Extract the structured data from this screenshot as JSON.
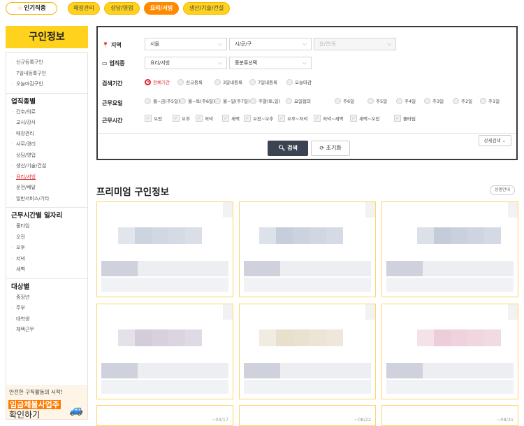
{
  "topbar": {
    "hot_label": "인기직종",
    "categories": [
      {
        "label": "매장관리",
        "active": false
      },
      {
        "label": "상담/영업",
        "active": false
      },
      {
        "label": "요리/서빙",
        "active": true
      },
      {
        "label": "생산/기술/건설",
        "active": false
      }
    ]
  },
  "sidebar": {
    "title": "구인정보",
    "recruit_items": [
      "신규등록구인",
      "7일내등록구인",
      "오늘마감구인"
    ],
    "job_head": "업직종별",
    "job_items": [
      "간호/의료",
      "교사/강사",
      "매장관리",
      "사무/경리",
      "상담/영업",
      "생산/기술/건설",
      "요리/서빙",
      "운전/배달",
      "일반서비스/기타"
    ],
    "job_selected": "요리/서빙",
    "time_head": "근무시간별 일자리",
    "time_items": [
      "풀타임",
      "오전",
      "오후",
      "저녁",
      "새벽"
    ],
    "target_head": "대상별",
    "target_items": [
      "중장년",
      "주부",
      "대학생",
      "재택근무"
    ],
    "ad": {
      "line1": "안전한 구직활동의 시작!",
      "highlight": "임금체불사업주",
      "line3": "확인하기"
    }
  },
  "filter": {
    "region_label": "지역",
    "region_select": "서울",
    "district_select": "시/군/구",
    "dong_select": "읍/면/동",
    "job_label": "업직종",
    "job_select": "요리/서빙",
    "job_sub_select": "중분류선택",
    "period_label": "검색기간",
    "period_options": [
      "전체기간",
      "신규등록",
      "3일내등록",
      "7일내등록",
      "오늘마감"
    ],
    "period_selected": 0,
    "days_label": "근무요일",
    "days_options": [
      "월~금(주5일)",
      "월~토(주6일)",
      "월~일(주7일)",
      "주말(토,일)",
      "요일협의",
      "주6일",
      "주5일",
      "주4일",
      "주3일",
      "주2일",
      "주1일"
    ],
    "hours_label": "근무시간",
    "hours_options": [
      "오전",
      "오후",
      "저녁",
      "새벽",
      "오전~오후",
      "오후~저녁",
      "저녁~새벽",
      "새벽~오전",
      "풀타임"
    ],
    "search_button": "검색",
    "reset_button": "초기화",
    "detail_button": "상세검색"
  },
  "premium": {
    "title": "프리미엄 구인정보",
    "guide": "상품안내",
    "card_dates": [
      "~04/17",
      "~08/22",
      "~08/31"
    ]
  },
  "colors": {
    "accent": "#ffd21e",
    "active": "#ff8a00",
    "selected": "#e0242f",
    "card_border": "#ffd56a"
  }
}
